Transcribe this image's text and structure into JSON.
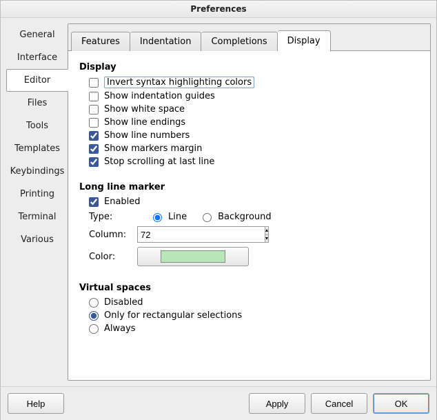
{
  "window": {
    "title": "Preferences"
  },
  "sidebar": {
    "items": [
      {
        "label": "General"
      },
      {
        "label": "Interface"
      },
      {
        "label": "Editor"
      },
      {
        "label": "Files"
      },
      {
        "label": "Tools"
      },
      {
        "label": "Templates"
      },
      {
        "label": "Keybindings"
      },
      {
        "label": "Printing"
      },
      {
        "label": "Terminal"
      },
      {
        "label": "Various"
      }
    ],
    "active_index": 2
  },
  "tabs": {
    "items": [
      {
        "label": "Features"
      },
      {
        "label": "Indentation"
      },
      {
        "label": "Completions"
      },
      {
        "label": "Display"
      }
    ],
    "active_index": 3
  },
  "display": {
    "title": "Display",
    "options": [
      {
        "label": "Invert syntax highlighting colors",
        "checked": false,
        "focused": true
      },
      {
        "label": "Show indentation guides",
        "checked": false
      },
      {
        "label": "Show white space",
        "checked": false
      },
      {
        "label": "Show line endings",
        "checked": false
      },
      {
        "label": "Show line numbers",
        "checked": true
      },
      {
        "label": "Show markers margin",
        "checked": true
      },
      {
        "label": "Stop scrolling at last line",
        "checked": true
      }
    ]
  },
  "long_line": {
    "title": "Long line marker",
    "enabled_label": "Enabled",
    "enabled": true,
    "type_label": "Type:",
    "type_options": {
      "line": "Line",
      "background": "Background"
    },
    "type_value": "line",
    "column_label": "Column:",
    "column_value": "72",
    "color_label": "Color:",
    "color_value": "#b7e6b7"
  },
  "virtual_spaces": {
    "title": "Virtual spaces",
    "options": [
      {
        "label": "Disabled"
      },
      {
        "label": "Only for rectangular selections"
      },
      {
        "label": "Always"
      }
    ],
    "value_index": 1
  },
  "footer": {
    "help": "Help",
    "apply": "Apply",
    "cancel": "Cancel",
    "ok": "OK"
  }
}
